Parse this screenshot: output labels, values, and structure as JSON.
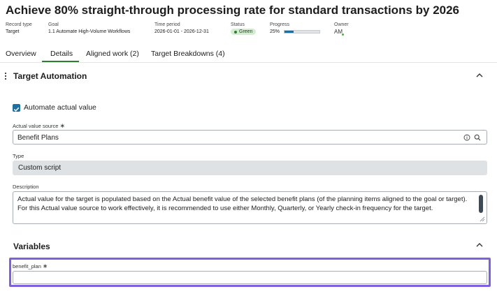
{
  "page": {
    "title": "Achieve 80% straight-through processing rate for standard transactions by 2026"
  },
  "meta": {
    "record_type_label": "Record type",
    "record_type_value": "Target",
    "goal_label": "Goal",
    "goal_value": "1.1 Automate High-Volume Workflows",
    "time_period_label": "Time period",
    "time_period_value": "2026-01-01 - 2026-12-31",
    "status_label": "Status",
    "status_value": "Green",
    "status_color": "#2e7d32",
    "progress_label": "Progress",
    "progress_value": "25%",
    "progress_fraction": 0.25,
    "owner_label": "Owner",
    "owner_initials": "AM"
  },
  "tabs": [
    {
      "label": "Overview"
    },
    {
      "label": "Details"
    },
    {
      "label": "Aligned work (2)"
    },
    {
      "label": "Target Breakdowns (4)"
    }
  ],
  "target_automation": {
    "section_title": "Target Automation",
    "checkbox_label": "Automate actual value",
    "checkbox_checked": true,
    "actual_source_label": "Actual value source",
    "actual_source_value": "Benefit Plans",
    "type_label": "Type",
    "type_value": "Custom script",
    "description_label": "Description",
    "description_value": "Actual value for the target is populated based on the Actual benefit value of the selected benefit plans (of the planning items aligned to the goal or target). For this Actual value source to work effectively, it is recommended to use either Monthly, Quarterly, or Yearly check-in frequency for the target."
  },
  "variables": {
    "section_title": "Variables",
    "benefit_plan_label": "benefit_plan",
    "benefit_plan_value": ""
  },
  "required_mark": "∗",
  "colors": {
    "accent": "#1f6f9e",
    "tab_active_underline": "#2f7d32",
    "highlight": "#7d5fe0"
  }
}
